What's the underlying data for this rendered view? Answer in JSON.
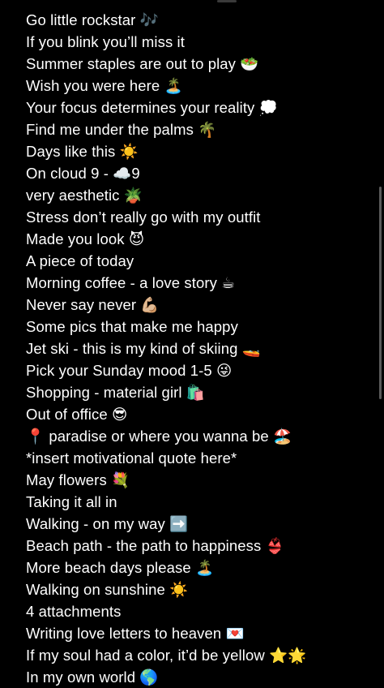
{
  "lines": [
    "Go little rockstar 🎶",
    "If you blink you’ll miss it",
    "Summer staples are out to play 🥗",
    "Wish you were here 🏝️",
    "Your focus determines your reality 💭",
    "Find me under the palms 🌴",
    "Days like this ☀️",
    "On cloud 9 - ☁️9",
    "very aesthetic 🪴",
    "Stress don’t really go with my outfit",
    "Made you look 😈",
    "A piece of today",
    "Morning coffee - a love story ☕",
    "Never say never 💪🏼",
    "Some pics that make me happy",
    "Jet ski - this is my kind of skiing 🚤",
    "Pick your Sunday mood 1-5 😜",
    "Shopping - material girl 🛍️",
    "Out of office 😎",
    "📍 paradise or where you wanna be 🏖️",
    "*insert motivational quote here*",
    "May flowers 💐",
    "Taking it all in",
    "Walking - on my way ➡️",
    "Beach path - the path to happiness 👙",
    "More beach days please 🏝️",
    "Walking on sunshine ☀️",
    "4 attachments",
    "Writing love letters to heaven 💌",
    "If my soul had a color, it’d be yellow ⭐🌟",
    "In my own world 🌎"
  ]
}
